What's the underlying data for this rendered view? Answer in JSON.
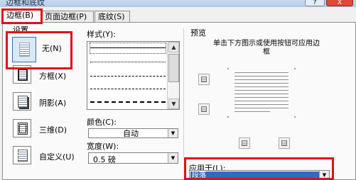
{
  "window": {
    "title": "边框和底纹",
    "help_glyph": "?",
    "close_glyph": "X"
  },
  "tabs": [
    {
      "label": "边框(B)",
      "active": true
    },
    {
      "label": "页面边框(P)",
      "active": false
    },
    {
      "label": "底纹(S)",
      "active": false
    }
  ],
  "settings": {
    "group_label": "设置",
    "items": [
      {
        "label": "无(N)",
        "icon": "no-border-icon",
        "selected": true
      },
      {
        "label": "方框(X)",
        "icon": "box-border-icon",
        "selected": false
      },
      {
        "label": "阴影(A)",
        "icon": "shadow-border-icon",
        "selected": false
      },
      {
        "label": "三维(D)",
        "icon": "3d-border-icon",
        "selected": false
      },
      {
        "label": "自定义(U)",
        "icon": "custom-border-icon",
        "selected": false
      }
    ]
  },
  "style": {
    "label": "样式(Y):",
    "lines": [
      "solid",
      "dotted",
      "dash-dot",
      "dashed-fine",
      "dashed",
      "dashed-long"
    ],
    "selected_index": 0
  },
  "color": {
    "label": "颜色(C):",
    "value": "自动"
  },
  "width": {
    "label": "宽度(W):",
    "value": "0.5 磅"
  },
  "preview": {
    "group_label": "预览",
    "instruction": "单击下方图示或使用按钮可应用边框",
    "buttons": [
      "top-border-icon",
      "bottom-border-icon",
      "left-border-icon",
      "right-border-icon"
    ]
  },
  "apply_to": {
    "label": "应用于(L):",
    "value": "段落"
  },
  "colors": {
    "highlight": "#e0101a",
    "selection": "#3169c6"
  }
}
